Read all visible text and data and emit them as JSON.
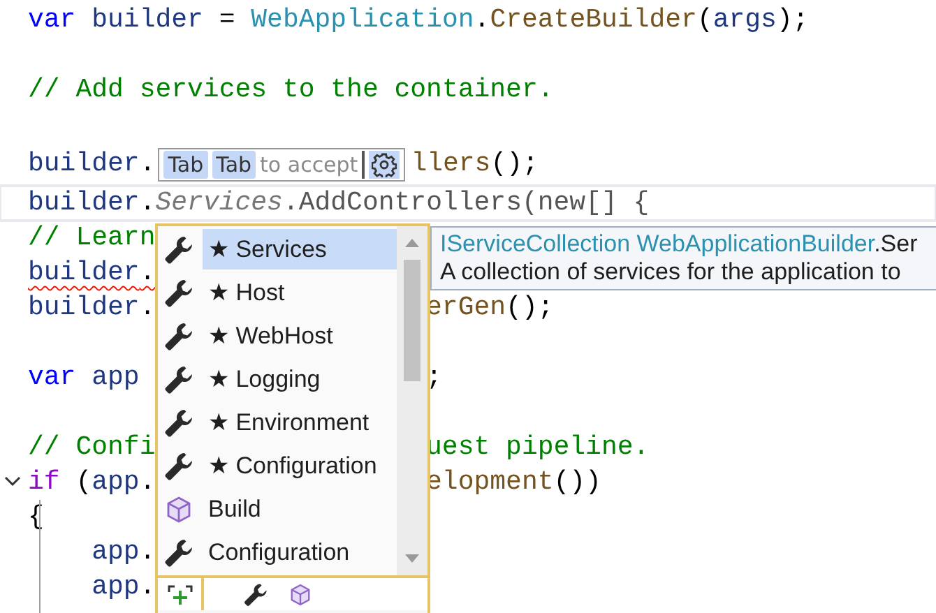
{
  "editor": {
    "lines": [
      {
        "left": [
          {
            "text": "var ",
            "kind": "keyword"
          },
          {
            "text": "builder",
            "kind": "local"
          },
          {
            "text": " = ",
            "kind": "plain"
          },
          {
            "text": "WebApplication",
            "kind": "type"
          },
          {
            "text": ".",
            "kind": "plain"
          },
          {
            "text": "CreateBuilder",
            "kind": "method"
          },
          {
            "text": "(",
            "kind": "plain"
          },
          {
            "text": "args",
            "kind": "local"
          },
          {
            "text": ");",
            "kind": "plain"
          }
        ]
      },
      {
        "kind": "blank"
      },
      {
        "left": [
          {
            "text": "// Add services to the container.",
            "kind": "comment"
          }
        ]
      },
      {
        "kind": "blank"
      },
      {
        "left": [
          {
            "text": "builder",
            "kind": "local"
          },
          {
            "text": ".",
            "kind": "plain"
          }
        ],
        "hint": {
          "keys": [
            "Tab",
            "Tab"
          ],
          "text": "to accept"
        },
        "right": [
          {
            "text": "llers",
            "kind": "method"
          },
          {
            "text": "();",
            "kind": "plain"
          }
        ]
      },
      {
        "current": true,
        "left": [
          {
            "text": "builder",
            "kind": "local"
          },
          {
            "text": ".",
            "kind": "plain"
          },
          {
            "text": "Services",
            "kind": "ghost-italic"
          },
          {
            "text": ".AddControllers(new[] {",
            "kind": "ghost"
          }
        ]
      },
      {
        "left": [
          {
            "text": "// Learn",
            "kind": "comment"
          }
        ]
      },
      {
        "error": true,
        "left": [
          {
            "text": "builder",
            "kind": "local"
          },
          {
            "text": ".",
            "kind": "plain"
          }
        ]
      },
      {
        "left": [
          {
            "text": "builder",
            "kind": "local"
          },
          {
            "text": ".",
            "kind": "plain"
          }
        ],
        "right": [
          {
            "text": "erGen",
            "kind": "method"
          },
          {
            "text": "();",
            "kind": "plain"
          }
        ]
      },
      {
        "kind": "blank"
      },
      {
        "left": [
          {
            "text": "var ",
            "kind": "keyword"
          },
          {
            "text": "app",
            "kind": "local"
          }
        ],
        "right": [
          {
            "text": ";",
            "kind": "plain"
          }
        ]
      },
      {
        "kind": "blank"
      },
      {
        "left": [
          {
            "text": "// Confi",
            "kind": "comment"
          }
        ],
        "right": [
          {
            "text": "uest pipeline.",
            "kind": "comment"
          }
        ]
      },
      {
        "fold": true,
        "left": [
          {
            "text": "if",
            "kind": "control"
          },
          {
            "text": " (",
            "kind": "plain"
          },
          {
            "text": "app",
            "kind": "local"
          },
          {
            "text": ".",
            "kind": "plain"
          }
        ],
        "right": [
          {
            "text": "elopment",
            "kind": "method"
          },
          {
            "text": "())",
            "kind": "plain"
          }
        ]
      },
      {
        "left": [
          {
            "text": "{",
            "kind": "plain"
          }
        ]
      },
      {
        "left": [
          {
            "text": "    app",
            "kind": "local"
          },
          {
            "text": ".",
            "kind": "plain"
          }
        ]
      },
      {
        "left": [
          {
            "text": "    app",
            "kind": "local"
          },
          {
            "text": ".",
            "kind": "plain"
          }
        ]
      }
    ]
  },
  "completion": {
    "items": [
      {
        "kind": "property",
        "label": "★ Services",
        "selected": true
      },
      {
        "kind": "property",
        "label": "★ Host",
        "selected": false
      },
      {
        "kind": "property",
        "label": "★ WebHost",
        "selected": false
      },
      {
        "kind": "property",
        "label": "★ Logging",
        "selected": false
      },
      {
        "kind": "property",
        "label": "★ Environment",
        "selected": false
      },
      {
        "kind": "property",
        "label": "★ Configuration",
        "selected": false
      },
      {
        "kind": "method",
        "label": "Build",
        "selected": false
      },
      {
        "kind": "property",
        "label": "Configuration",
        "selected": false
      }
    ]
  },
  "tooltip": {
    "signature": [
      {
        "text": "IServiceCollection WebApplicationBuilder",
        "kind": "type"
      },
      {
        "text": ".Ser",
        "kind": "plain"
      }
    ],
    "description": "A collection of services for the application to"
  }
}
